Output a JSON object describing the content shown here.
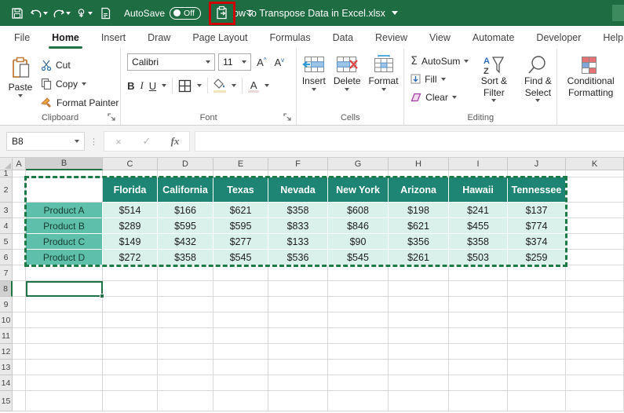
{
  "colors": {
    "titlebar": "#1E6C41",
    "accent_green": "#217346",
    "table_header_bg": "#1E8474",
    "table_label_bg": "#5EC0AB",
    "table_value_bg": "#DAF0EA",
    "highlight_box_red": "#CE0000"
  },
  "titlebar": {
    "title": "How to Transpose Data in Excel.xlsx",
    "autosave_label": "AutoSave",
    "autosave_state": "Off"
  },
  "tabs": {
    "items": [
      {
        "label": "File",
        "active": false
      },
      {
        "label": "Home",
        "active": true
      },
      {
        "label": "Insert",
        "active": false
      },
      {
        "label": "Draw",
        "active": false
      },
      {
        "label": "Page Layout",
        "active": false
      },
      {
        "label": "Formulas",
        "active": false
      },
      {
        "label": "Data",
        "active": false
      },
      {
        "label": "Review",
        "active": false
      },
      {
        "label": "View",
        "active": false
      },
      {
        "label": "Automate",
        "active": false
      },
      {
        "label": "Developer",
        "active": false
      },
      {
        "label": "Help",
        "active": false
      }
    ]
  },
  "ribbon": {
    "clipboard": {
      "group_label": "Clipboard",
      "paste": "Paste",
      "cut": "Cut",
      "copy": "Copy",
      "format_painter": "Format Painter"
    },
    "font": {
      "group_label": "Font",
      "font_name": "Calibri",
      "font_size": "11",
      "bold": "B",
      "italic": "I",
      "underline": "U",
      "grow_font": "A",
      "shrink_font": "A"
    },
    "cells": {
      "group_label": "Cells",
      "insert": "Insert",
      "delete": "Delete",
      "format": "Format"
    },
    "editing": {
      "group_label": "Editing",
      "autosum": "AutoSum",
      "fill": "Fill",
      "clear": "Clear",
      "sort_filter": "Sort & Filter",
      "find_select": "Find & Select"
    },
    "conditional": {
      "label": "Conditional Formatting"
    }
  },
  "formula_bar": {
    "name_box": "B8",
    "cancel": "×",
    "enter": "✓",
    "fx": "fx",
    "content": ""
  },
  "sheet": {
    "columns": [
      "A",
      "B",
      "C",
      "D",
      "E",
      "F",
      "G",
      "H",
      "I",
      "J",
      "K"
    ],
    "rows": [
      "1",
      "2",
      "3",
      "4",
      "5",
      "6",
      "7",
      "8",
      "9",
      "10",
      "11",
      "12",
      "13",
      "14",
      "15"
    ],
    "selected_cell": "B8",
    "selected_column": "B",
    "selected_row": "8",
    "copied_range": "B2:J6",
    "table": {
      "state_headers": [
        "Florida",
        "California",
        "Texas",
        "Nevada",
        "New York",
        "Arizona",
        "Hawaii",
        "Tennessee"
      ],
      "products": [
        {
          "name": "Product A",
          "values": [
            "$514",
            "$166",
            "$621",
            "$358",
            "$608",
            "$198",
            "$241",
            "$137"
          ]
        },
        {
          "name": "Product B",
          "values": [
            "$289",
            "$595",
            "$595",
            "$833",
            "$846",
            "$621",
            "$455",
            "$774"
          ]
        },
        {
          "name": "Product C",
          "values": [
            "$149",
            "$432",
            "$277",
            "$133",
            "$90",
            "$356",
            "$358",
            "$374"
          ]
        },
        {
          "name": "Product D",
          "values": [
            "$272",
            "$358",
            "$545",
            "$536",
            "$545",
            "$261",
            "$503",
            "$259"
          ]
        }
      ]
    }
  }
}
